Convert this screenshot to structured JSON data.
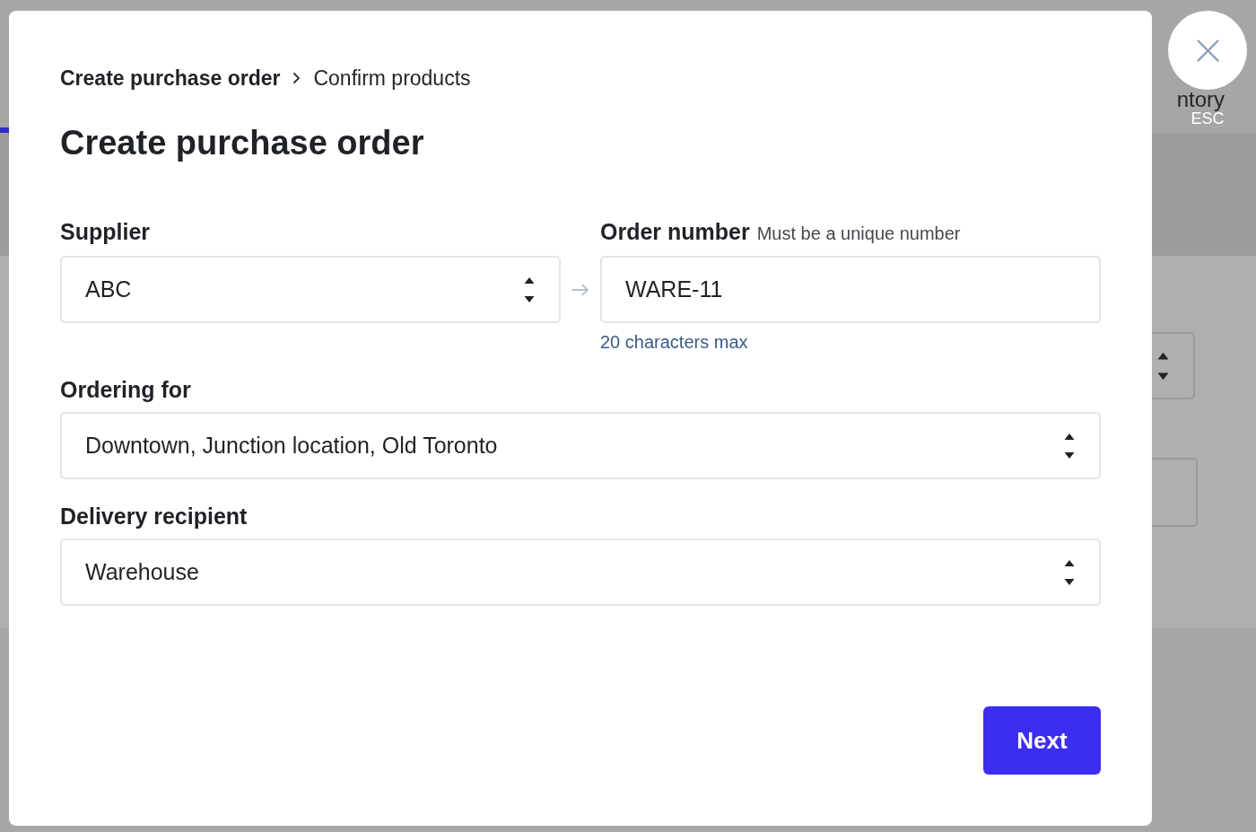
{
  "background": {
    "tab_text": "ntory",
    "fields": [
      {
        "kind": "select"
      },
      {
        "kind": "text"
      }
    ]
  },
  "close_button": {
    "shortcut": "ESC"
  },
  "modal": {
    "breadcrumb": [
      {
        "label": "Create purchase order",
        "current": true
      },
      {
        "label": "Confirm products",
        "current": false
      }
    ],
    "title": "Create purchase order",
    "fields": [
      {
        "kind": "select",
        "label": "Supplier",
        "value": "ABC"
      },
      {
        "kind": "text",
        "label": "Order number",
        "hint": "Must be a unique number",
        "value": "WARE-11",
        "help": "20 characters max"
      },
      {
        "kind": "select",
        "label": "Ordering for",
        "value": "Downtown, Junction location, Old Toronto"
      },
      {
        "kind": "select",
        "label": "Delivery recipient",
        "value": "Warehouse"
      }
    ],
    "next_button": "Next"
  }
}
